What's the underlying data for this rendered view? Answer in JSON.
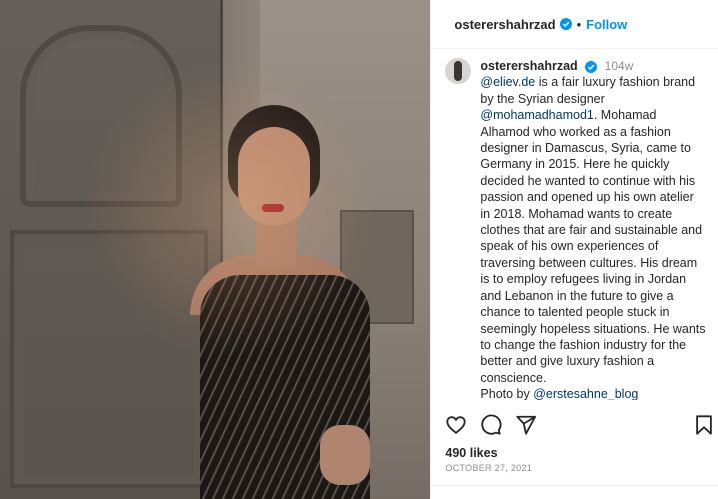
{
  "post": {
    "username": "osterershahrzad",
    "follow_label": "Follow",
    "dot": "•"
  },
  "caption": {
    "username": "osterershahrzad",
    "time": "104w",
    "mention1": "@eliev.de",
    "text1": " is a fair luxury fashion brand by the Syrian designer ",
    "mention2": "@mohamadhamod1",
    "text2": ". Mohamad Alhamod who worked as a fashion designer in Damascus, Syria, came to Germany in 2015. Here he quickly decided he wanted to continue with his passion and opened up his own atelier in 2018. Mohamad wants to create clothes that are fair and sustainable and speak of his own experiences of traversing between cultures. His dream is to employ refugees living in Jordan and Lebanon in the future to give a chance to talented people stuck in seemingly hopeless situations. He wants to change the fashion industry for the better and give luxury fashion a conscience.",
    "photo_by": "Photo by ",
    "mention3": "@erstesahne_blog"
  },
  "stats": {
    "likes": "490 likes",
    "date": "OCTOBER 27, 2021"
  },
  "icons": {
    "verified": "verified-badge-icon",
    "like": "heart-icon",
    "comment": "comment-icon",
    "share": "paper-plane-icon",
    "save": "bookmark-icon"
  },
  "colors": {
    "accent": "#0095f6",
    "mention": "#00376b",
    "muted": "#8e8e8e"
  }
}
